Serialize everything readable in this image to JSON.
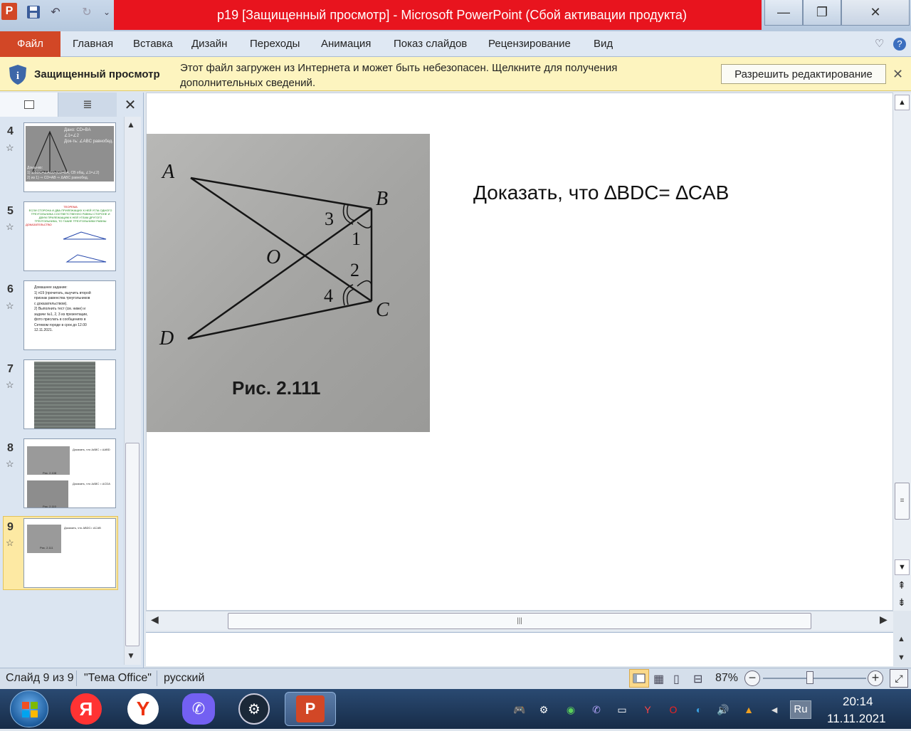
{
  "window": {
    "title": "p19 [Защищенный просмотр]  -  Microsoft PowerPoint (Сбой активации продукта)",
    "minimize": "—",
    "restore": "❐",
    "close": "✕"
  },
  "qat": {
    "app_icon": "P",
    "save": "💾",
    "undo": "↶",
    "redo": "↻",
    "more": "⌄"
  },
  "ribbon": {
    "file": "Файл",
    "tabs": [
      "Главная",
      "Вставка",
      "Дизайн",
      "Переходы",
      "Анимация",
      "Показ слайдов",
      "Рецензирование",
      "Вид"
    ],
    "collapse": "♡",
    "help": "?"
  },
  "message_bar": {
    "icon": "shield-icon",
    "title": "Защищенный просмотр",
    "text": "Этот файл загружен из Интернета и может быть небезопасен. Щелкните для получения дополнительных сведений.",
    "button": "Разрешить редактирование",
    "close": "✕"
  },
  "panel": {
    "close": "✕",
    "slides": [
      {
        "num": "4",
        "lines": [
          "Дано: CD=BA",
          "∠1=∠2",
          "Док-ть: ∠ABC равнобед.",
          "Доказ-во:",
          "1) ∠BDC=∠ACD (CD=BA, CB общ, ∠1=∠2)",
          "2) из 1) ⇒ CD=AB ⇒ ΔABC равнобед."
        ]
      },
      {
        "num": "5",
        "lines": [
          "ТЕОРЕМА",
          "ЕСЛИ СТОРОНА И ДВА ПРИЛЕЖАЩИХ К НЕЙ УГЛА ОДНОГО",
          "ТРЕУГОЛЬНИКА СООТВЕТСТВЕННО РАВНЫ СТОРОНЕ И",
          "ДВУМ ПРИЛЕЖАЩИМ К НЕЙ УГЛАМ ДРУГОГО",
          "ТРЕУГОЛЬНИКА, ТО ТАКИЕ ТРЕУГОЛЬНИКИ РАВНЫ",
          "ДОКАЗАТЕЛЬСТВО"
        ]
      },
      {
        "num": "6",
        "lines": [
          "Домашнее задание:",
          "1) п19 (прочитать, выучить второй",
          "признак равенства треугольников",
          "с доказательством).",
          "2) Выполнить тест (см. ниже) и",
          "задачи №1, 2, 3 из презентации,",
          "фото прислать в сообщениях в",
          "Сетевом городе в срок до 12.00",
          "12.11.2021."
        ]
      },
      {
        "num": "7",
        "lines": []
      },
      {
        "num": "8",
        "lines": [
          "Доказать, что ΔABC = ΔABD",
          "Доказать, что ΔABC = ΔCDA",
          "Рис. 2.108",
          "Рис. 2.110"
        ]
      },
      {
        "num": "9",
        "lines": [
          "Доказать, что ΔBDC= ΔCAB",
          "Рис. 2.111"
        ]
      }
    ]
  },
  "slide": {
    "heading": "Доказать,  что ∆BDC= ∆CAB",
    "figure": {
      "caption": "Рис. 2.111",
      "labels": {
        "A": "A",
        "B": "B",
        "C": "C",
        "D": "D",
        "O": "O",
        "a1": "1",
        "a2": "2",
        "a3": "3",
        "a4": "4"
      }
    }
  },
  "status": {
    "slide": "Слайд 9 из 9",
    "theme": "\"Тема Office\"",
    "lang": "русский",
    "zoom": "87%",
    "zoom_fraction": 0.45
  },
  "taskbar": {
    "start": "start-orb",
    "apps": [
      "yandex-browser",
      "yandex",
      "viber",
      "steam",
      "powerpoint"
    ],
    "yandex_label": "Я",
    "lang": "Ru",
    "time": "20:14",
    "date": "11.11.2021"
  }
}
